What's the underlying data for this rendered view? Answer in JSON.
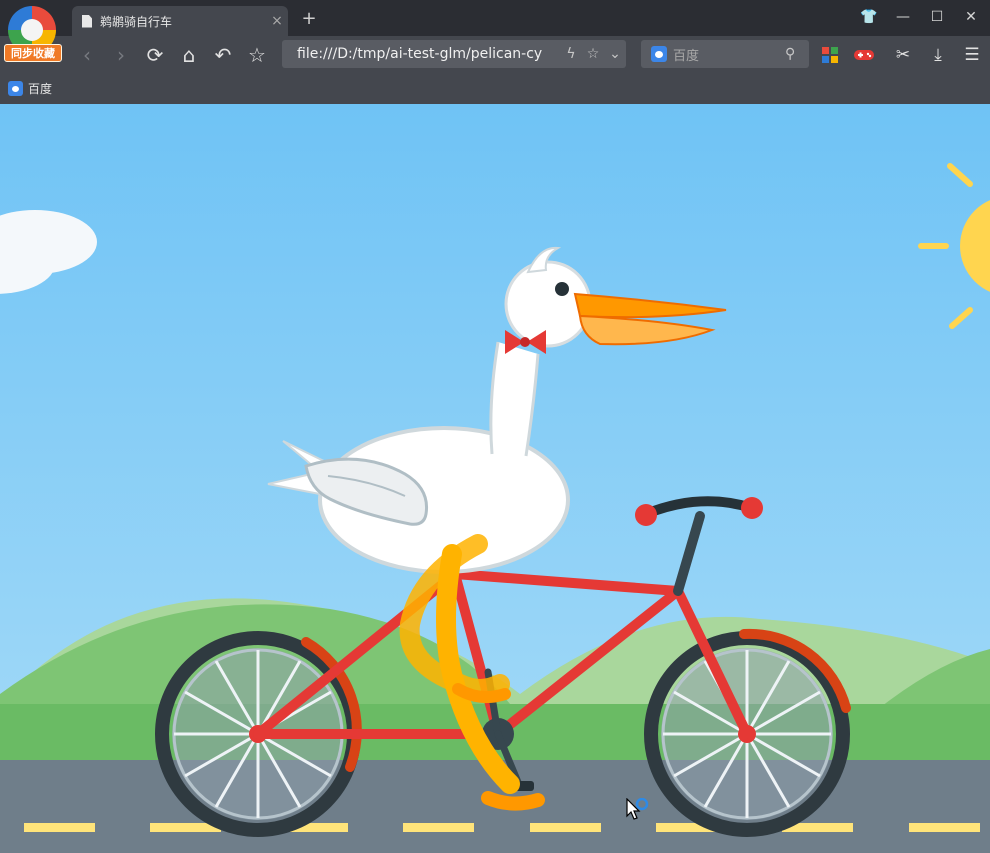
{
  "browser": {
    "sync_badge": "同步收藏",
    "tab": {
      "title": "鹈鹕骑自行车",
      "close": "×"
    },
    "new_tab": "+",
    "window_controls": {
      "skin": "👕",
      "minimize": "—",
      "maximize": "☐",
      "close": "✕"
    },
    "nav": {
      "back": "‹",
      "forward": "›",
      "reload": "⟳",
      "home": "⌂",
      "undo": "↶",
      "favorite": "☆"
    },
    "address": {
      "url": "file:///D:/tmp/ai-test-glm/pelican-cy",
      "lightning": "ϟ",
      "star": "☆",
      "dropdown": "⌄"
    },
    "search": {
      "placeholder": "百度",
      "icon": "⚲"
    },
    "tools": {
      "apps": "apps-icon",
      "game": "gamepad-icon",
      "scissors": "✂",
      "download": "⤓",
      "menu": "☰"
    },
    "bookmarks": [
      {
        "label": "百度"
      }
    ]
  },
  "scene": {
    "colors": {
      "sky_top": "#6fc3f5",
      "sky_bottom": "#a8dcf8",
      "hill_light": "#a9d79c",
      "hill_dark": "#7ec574",
      "grass": "#6abb64",
      "road": "#6f7e8a",
      "road_line": "#ffe47a",
      "sun": "#ffd54f",
      "frame": "#e53935",
      "tire": "#2f3a40",
      "fender": "#d84315",
      "leg": "#ffb300",
      "beak": "#ff9800",
      "bowtie": "#e53935",
      "body": "#ffffff"
    }
  }
}
